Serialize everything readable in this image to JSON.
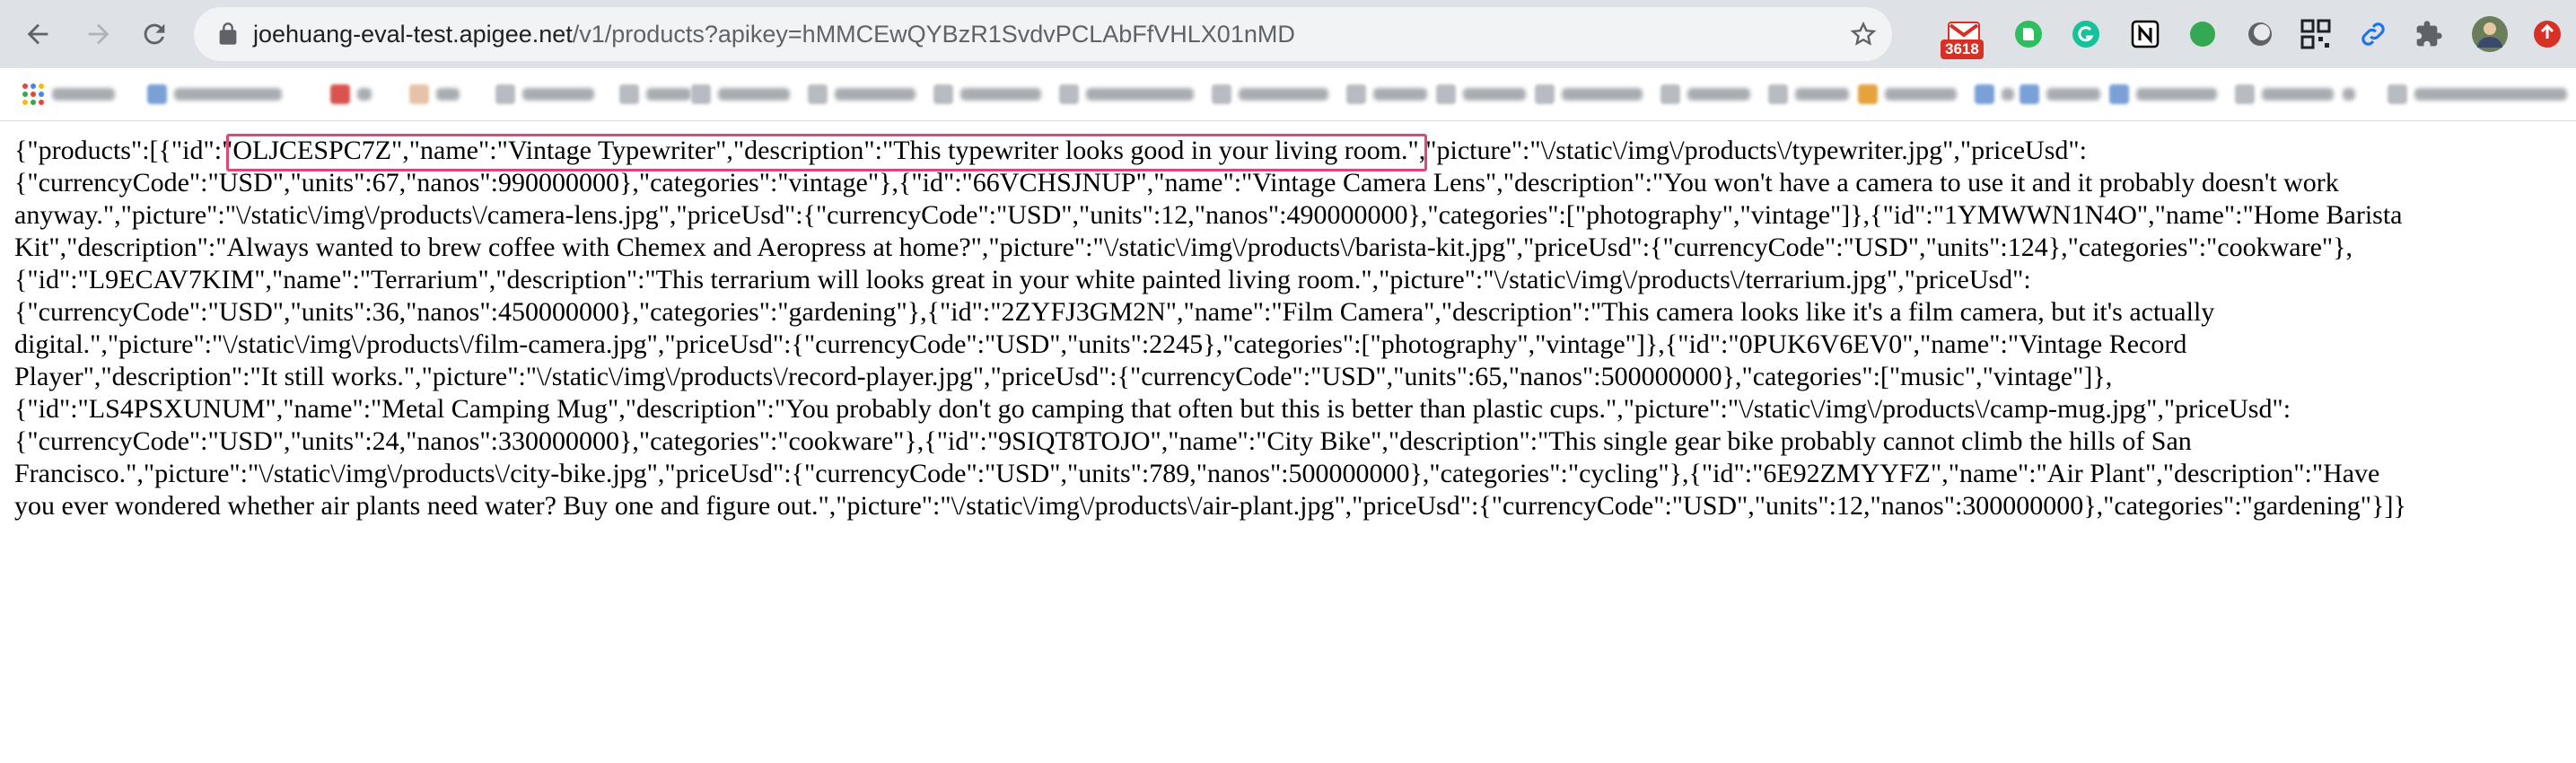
{
  "browser": {
    "url_host": "joehuang-eval-test.apigee.net",
    "url_path": "/v1/products?apikey=hMMCEwQYBzR1SvdvPCLAbFfVHLX01nMD",
    "gmail_badge": "3618",
    "icons": [
      "back-icon",
      "forward-icon",
      "reload-icon",
      "lock-icon",
      "star-icon",
      "gmail-icon",
      "evernote-icon",
      "grammarly-icon",
      "notion-icon",
      "green-circle-icon",
      "toggle-icon",
      "qr-icon",
      "link-icon",
      "puzzle-icon",
      "avatar",
      "update-icon"
    ],
    "colors": {
      "toolbar": "#dee1e6",
      "omnibox": "#f1f3f4",
      "highlight": "#e0457b"
    }
  },
  "response": {
    "lines": [
      "{\"products\":[{\"id\":\"OLJCESPC7Z\",\"name\":\"Vintage Typewriter\",\"description\":\"This typewriter looks good in your living room.\",\"picture\":\"\\/static\\/img\\/products\\/typewriter.jpg\",\"priceUsd\":",
      "{\"currencyCode\":\"USD\",\"units\":67,\"nanos\":990000000},\"categories\":\"vintage\"},{\"id\":\"66VCHSJNUP\",\"name\":\"Vintage Camera Lens\",\"description\":\"You won't have a camera to use it and it probably doesn't work",
      "anyway.\",\"picture\":\"\\/static\\/img\\/products\\/camera-lens.jpg\",\"priceUsd\":{\"currencyCode\":\"USD\",\"units\":12,\"nanos\":490000000},\"categories\":[\"photography\",\"vintage\"]},{\"id\":\"1YMWWN1N4O\",\"name\":\"Home Barista",
      "Kit\",\"description\":\"Always wanted to brew coffee with Chemex and Aeropress at home?\",\"picture\":\"\\/static\\/img\\/products\\/barista-kit.jpg\",\"priceUsd\":{\"currencyCode\":\"USD\",\"units\":124},\"categories\":\"cookware\"},",
      "{\"id\":\"L9ECAV7KIM\",\"name\":\"Terrarium\",\"description\":\"This terrarium will looks great in your white painted living room.\",\"picture\":\"\\/static\\/img\\/products\\/terrarium.jpg\",\"priceUsd\":",
      "{\"currencyCode\":\"USD\",\"units\":36,\"nanos\":450000000},\"categories\":\"gardening\"},{\"id\":\"2ZYFJ3GM2N\",\"name\":\"Film Camera\",\"description\":\"This camera looks like it's a film camera, but it's actually",
      "digital.\",\"picture\":\"\\/static\\/img\\/products\\/film-camera.jpg\",\"priceUsd\":{\"currencyCode\":\"USD\",\"units\":2245},\"categories\":[\"photography\",\"vintage\"]},{\"id\":\"0PUK6V6EV0\",\"name\":\"Vintage Record",
      "Player\",\"description\":\"It still works.\",\"picture\":\"\\/static\\/img\\/products\\/record-player.jpg\",\"priceUsd\":{\"currencyCode\":\"USD\",\"units\":65,\"nanos\":500000000},\"categories\":[\"music\",\"vintage\"]},",
      "{\"id\":\"LS4PSXUNUM\",\"name\":\"Metal Camping Mug\",\"description\":\"You probably don't go camping that often but this is better than plastic cups.\",\"picture\":\"\\/static\\/img\\/products\\/camp-mug.jpg\",\"priceUsd\":",
      "{\"currencyCode\":\"USD\",\"units\":24,\"nanos\":330000000},\"categories\":\"cookware\"},{\"id\":\"9SIQT8TOJO\",\"name\":\"City Bike\",\"description\":\"This single gear bike probably cannot climb the hills of San",
      "Francisco.\",\"picture\":\"\\/static\\/img\\/products\\/city-bike.jpg\",\"priceUsd\":{\"currencyCode\":\"USD\",\"units\":789,\"nanos\":500000000},\"categories\":\"cycling\"},{\"id\":\"6E92ZMYYFZ\",\"name\":\"Air Plant\",\"description\":\"Have",
      "you ever wondered whether air plants need water? Buy one and figure out.\",\"picture\":\"\\/static\\/img\\/products\\/air-plant.jpg\",\"priceUsd\":{\"currencyCode\":\"USD\",\"units\":12,\"nanos\":300000000},\"categories\":\"gardening\"}]}"
    ]
  }
}
